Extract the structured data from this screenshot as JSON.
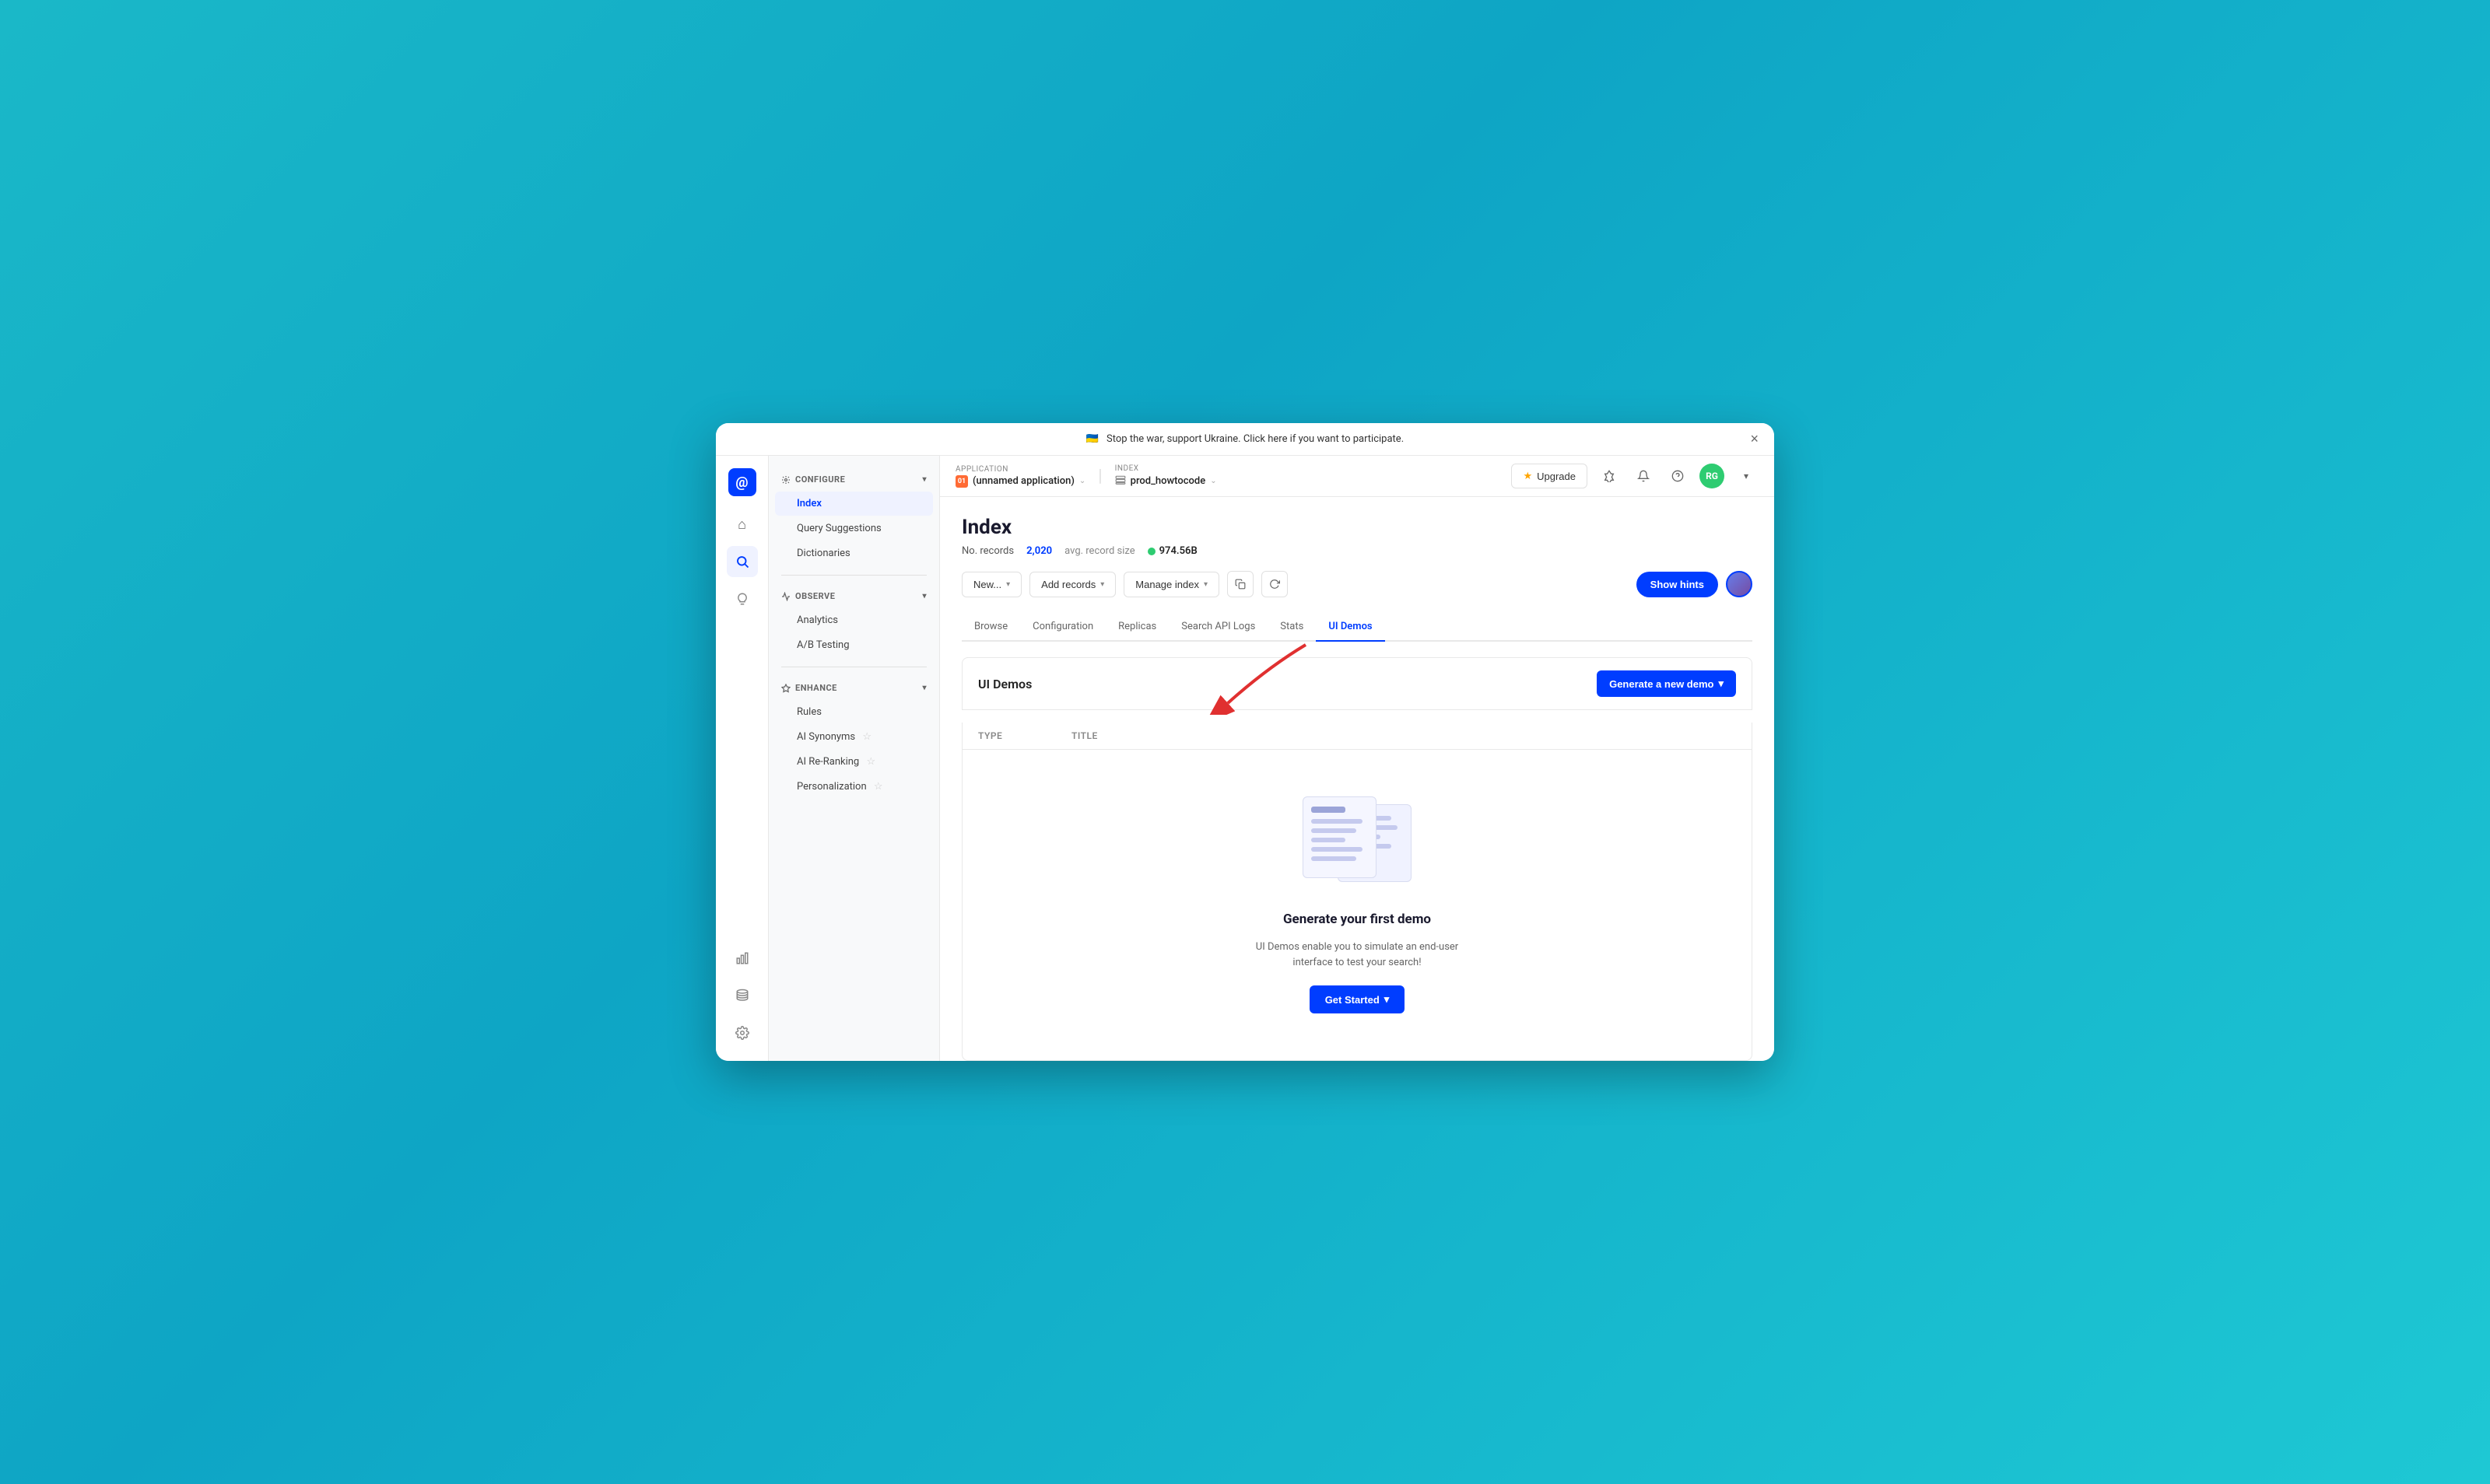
{
  "banner": {
    "flag": "🇺🇦",
    "text": "Stop the war, support Ukraine. Click here if you want to participate.",
    "close_label": "×"
  },
  "icon_nav": {
    "logo_text": "@",
    "items": [
      {
        "name": "home",
        "icon": "⌂",
        "active": false
      },
      {
        "name": "search",
        "icon": "⊙",
        "active": true
      },
      {
        "name": "lightbulb",
        "icon": "💡",
        "active": false
      }
    ],
    "bottom": [
      {
        "name": "analytics",
        "icon": "📊"
      },
      {
        "name": "database",
        "icon": "🗄"
      },
      {
        "name": "settings",
        "icon": "⚙"
      }
    ]
  },
  "sidebar": {
    "configure_label": "CONFIGURE",
    "configure_items": [
      {
        "label": "Index",
        "active": true
      },
      {
        "label": "Query Suggestions",
        "active": false
      },
      {
        "label": "Dictionaries",
        "active": false
      }
    ],
    "observe_label": "OBSERVE",
    "observe_items": [
      {
        "label": "Analytics",
        "active": false
      },
      {
        "label": "A/B Testing",
        "active": false
      }
    ],
    "enhance_label": "ENHANCE",
    "enhance_items": [
      {
        "label": "Rules",
        "active": false
      },
      {
        "label": "AI Synonyms",
        "active": false
      },
      {
        "label": "AI Re-Ranking",
        "active": false
      },
      {
        "label": "Personalization",
        "active": false
      }
    ]
  },
  "topbar": {
    "app_label": "Application",
    "app_dot": "01",
    "app_name": "(unnamed application)",
    "index_label": "Index",
    "index_name": "prod_howtocode",
    "upgrade_label": "Upgrade"
  },
  "page": {
    "title": "Index",
    "records_label": "No. records",
    "records_count": "2,020",
    "avg_label": "avg. record size",
    "record_size": "974.56B"
  },
  "toolbar": {
    "new_label": "New...",
    "add_records_label": "Add records",
    "manage_index_label": "Manage index",
    "show_hints_label": "Show hints"
  },
  "tabs": [
    {
      "label": "Browse",
      "active": false
    },
    {
      "label": "Configuration",
      "active": false
    },
    {
      "label": "Replicas",
      "active": false
    },
    {
      "label": "Search API Logs",
      "active": false
    },
    {
      "label": "Stats",
      "active": false
    },
    {
      "label": "UI Demos",
      "active": true
    }
  ],
  "demos": {
    "title": "UI Demos",
    "generate_btn": "Generate a new demo",
    "col_type": "Type",
    "col_title": "Title",
    "empty_title": "Generate your first demo",
    "empty_subtitle": "UI Demos enable you to simulate an end-user interface to test your search!",
    "get_started_label": "Get Started"
  }
}
